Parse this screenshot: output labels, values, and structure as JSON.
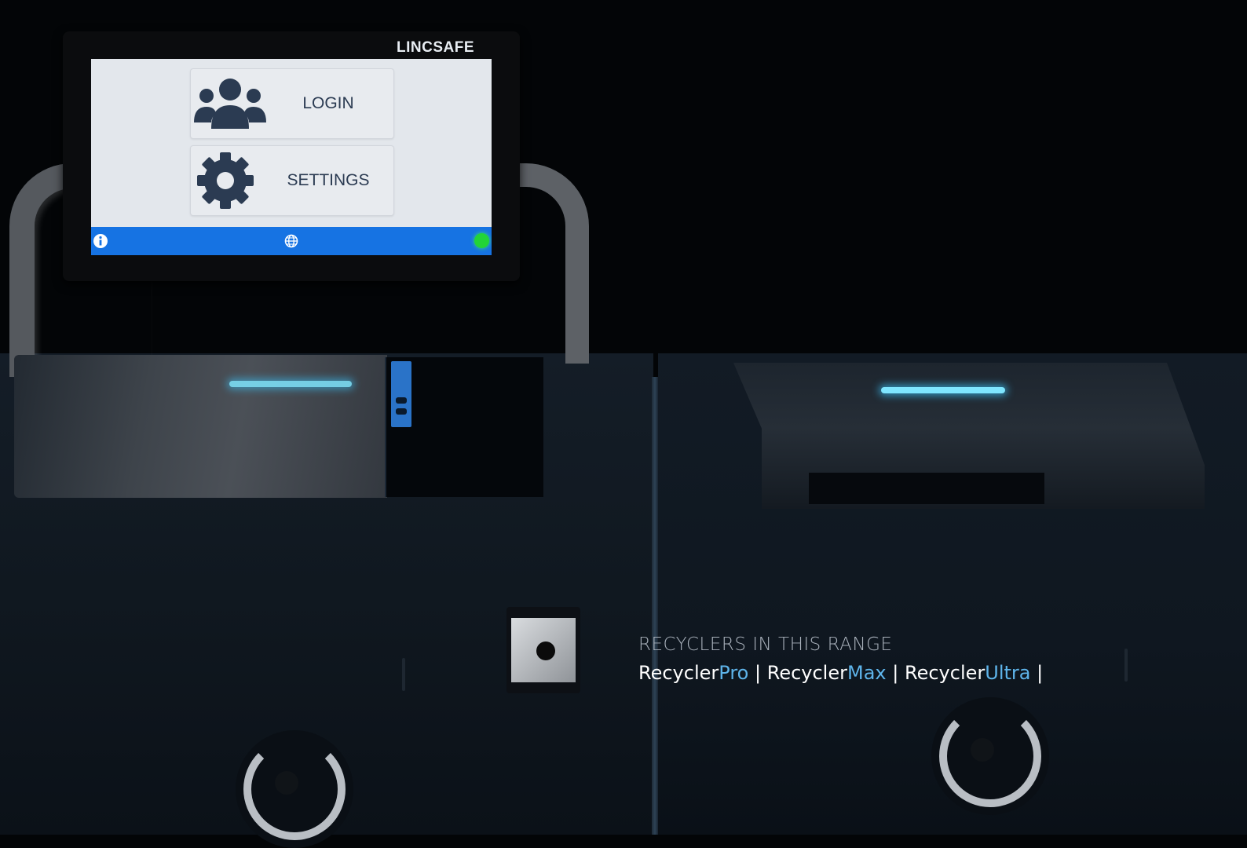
{
  "device": {
    "brand": "LINCSAFE"
  },
  "screen": {
    "menu": [
      {
        "label": "LOGIN",
        "icon": "users-icon"
      },
      {
        "label": "SETTINGS",
        "icon": "gear-icon"
      }
    ],
    "status_bar": {
      "left_icon": "info-icon",
      "center_icon": "globe-icon",
      "right_indicator": "status-dot",
      "bar_color": "#1673e3",
      "indicator_color": "#22d437"
    }
  },
  "caption": {
    "title": "RECYCLERS IN THIS RANGE",
    "separator": "|",
    "products": [
      {
        "prefix": "Recycler",
        "suffix": "Pro"
      },
      {
        "prefix": "Recycler",
        "suffix": "Max"
      },
      {
        "prefix": "Recycler",
        "suffix": "Ultra"
      }
    ],
    "accent_color": "#5eb4ea"
  }
}
